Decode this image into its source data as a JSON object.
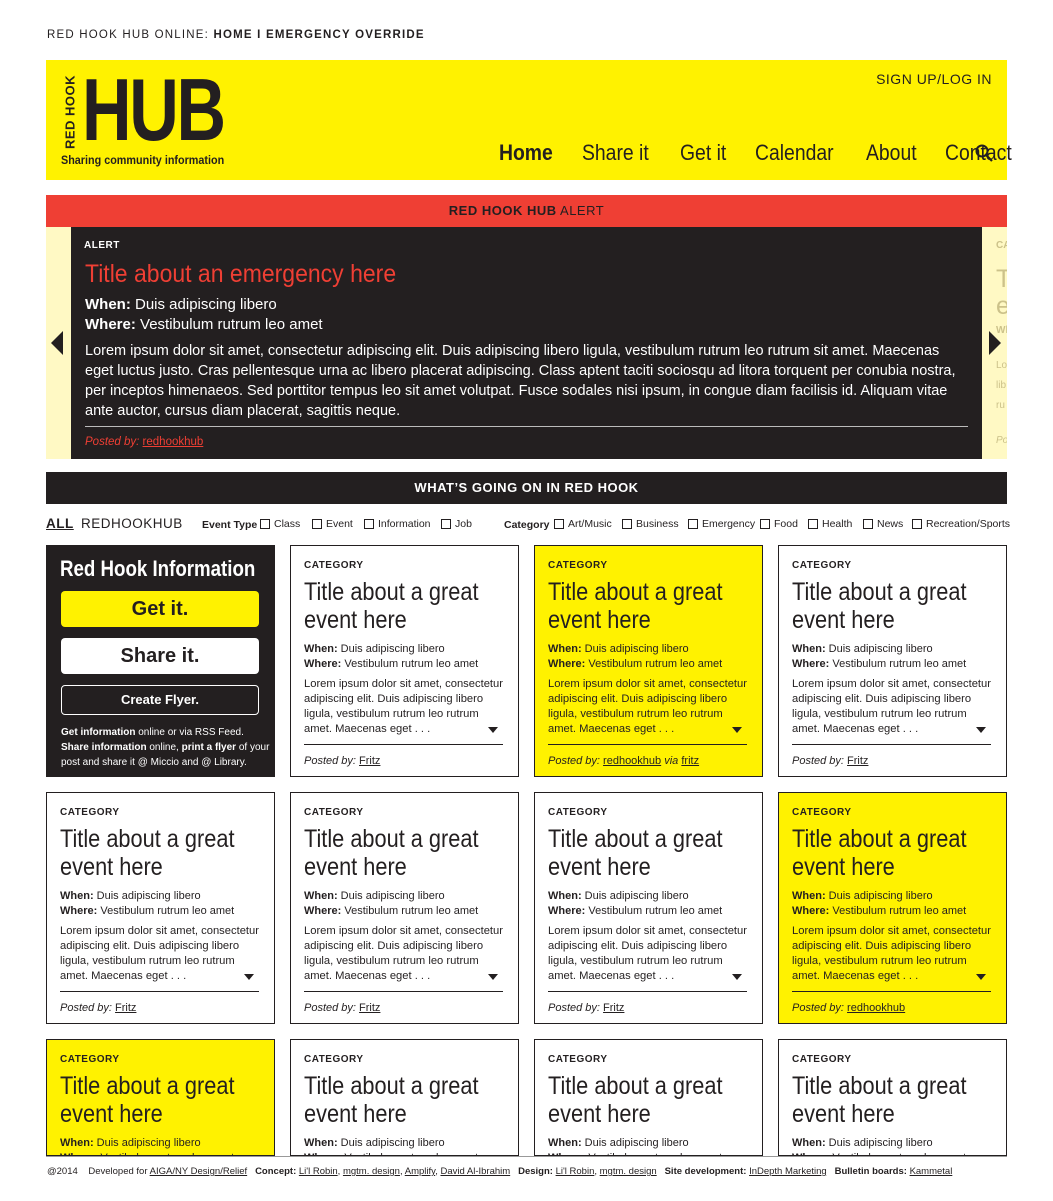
{
  "topline": {
    "site": "RED HOOK HUB ONLINE:",
    "home": "HOME",
    "sep": "I",
    "override": "EMERGENCY OVERRIDE"
  },
  "header": {
    "logo_vertical": "RED HOOK",
    "logo_main": "HUB",
    "tagline": "Sharing community information",
    "signup": "SIGN UP/LOG IN",
    "nav": [
      "Home",
      "Share it",
      "Get it",
      "Calendar",
      "About",
      "Contact"
    ]
  },
  "alert": {
    "bar_bold": "RED HOOK HUB",
    "bar_rest": "ALERT",
    "label": "ALERT",
    "title": "Title about an emergency here",
    "when_label": "When:",
    "when": "Duis adipiscing libero",
    "where_label": "Where:",
    "where": "Vestibulum rutrum leo amet",
    "body": "Lorem ipsum dolor sit amet, consectetur adipiscing elit. Duis adipiscing libero ligula, vestibulum rutrum leo rutrum sit amet. Maecenas eget luctus justo. Cras pellentesque urna ac libero placerat adipiscing. Class aptent taciti sociosqu ad litora torquent per conubia nostra, per inceptos himenaeos. Sed porttitor tempus leo sit amet volutpat. Fusce sodales nisi ipsum, in congue diam facilisis id. Aliquam vitae ante auctor, cursus diam placerat, sagittis neque.",
    "posted_label": "Posted by:",
    "posted_by": "redhookhub",
    "ghost": {
      "cat": "CA",
      "t1": "T",
      "t2": "e",
      "wh": "Wh",
      "l1": "Lo",
      "l2": "lib",
      "l3": "ru",
      "p": "Po"
    }
  },
  "wgo": {
    "title": "WHAT’S GOING ON IN RED HOOK"
  },
  "filters": {
    "tab_all": "ALL",
    "tab_hub": "REDHOOKHUB",
    "event_type_label": "Event Type",
    "event_types": [
      "Class",
      "Event",
      "Information",
      "Job"
    ],
    "category_label": "Category",
    "categories": [
      "Art/Music",
      "Business",
      "Emergency",
      "Food",
      "Health",
      "News",
      "Recreation/Sports"
    ]
  },
  "info_box": {
    "title": "Red Hook Information",
    "get": "Get it.",
    "share": "Share it.",
    "flyer": "Create Flyer.",
    "t1b": "Get information",
    "t1": " online or via RSS Feed.",
    "t2b": "Share information",
    "t2": " online, ",
    "t3b": "print a flyer",
    "t3": " of your post and share it @ Miccio and @ Library."
  },
  "card_template": {
    "category": "CATEGORY",
    "title": "Title about a great event here",
    "when_label": "When:",
    "when": "Duis adipiscing libero",
    "where_label": "Where:",
    "where": "Vestibulum rutrum leo amet",
    "desc": "Lorem ipsum dolor sit amet, consectetur adipiscing elit. Duis adipiscing libero ligula, vestibulum rutrum leo rutrum amet. Maecenas eget . . .",
    "posted_label": "Posted by:",
    "via": "via"
  },
  "cards": [
    {
      "posted_by": "Fritz"
    },
    {
      "posted_by": "redhookhub",
      "via_user": "fritz"
    },
    {
      "posted_by": "Fritz"
    },
    {
      "posted_by": "Fritz"
    },
    {
      "posted_by": "Fritz"
    },
    {
      "posted_by": "Fritz"
    },
    {
      "posted_by": "redhookhub"
    },
    {},
    {},
    {},
    {}
  ],
  "footer": {
    "copy": "@2014",
    "dev": "Developed for",
    "dev_link": "AIGA/NY Design/Relief",
    "concept_label": "Concept:",
    "concept": [
      "Li'l Robin",
      "mgtm. design",
      "Amplify",
      "David Al-Ibrahim"
    ],
    "design_label": "Design:",
    "design": [
      "Li'l Robin",
      "mgtm. design"
    ],
    "site_label": "Site development:",
    "site": "InDepth Marketing",
    "boards_label": "Bulletin boards:",
    "boards": "Kammetal"
  },
  "colors": {
    "yellow": "#fff200",
    "red": "#ef3f34",
    "dark": "#231f20",
    "cream": "#fff9c4"
  }
}
